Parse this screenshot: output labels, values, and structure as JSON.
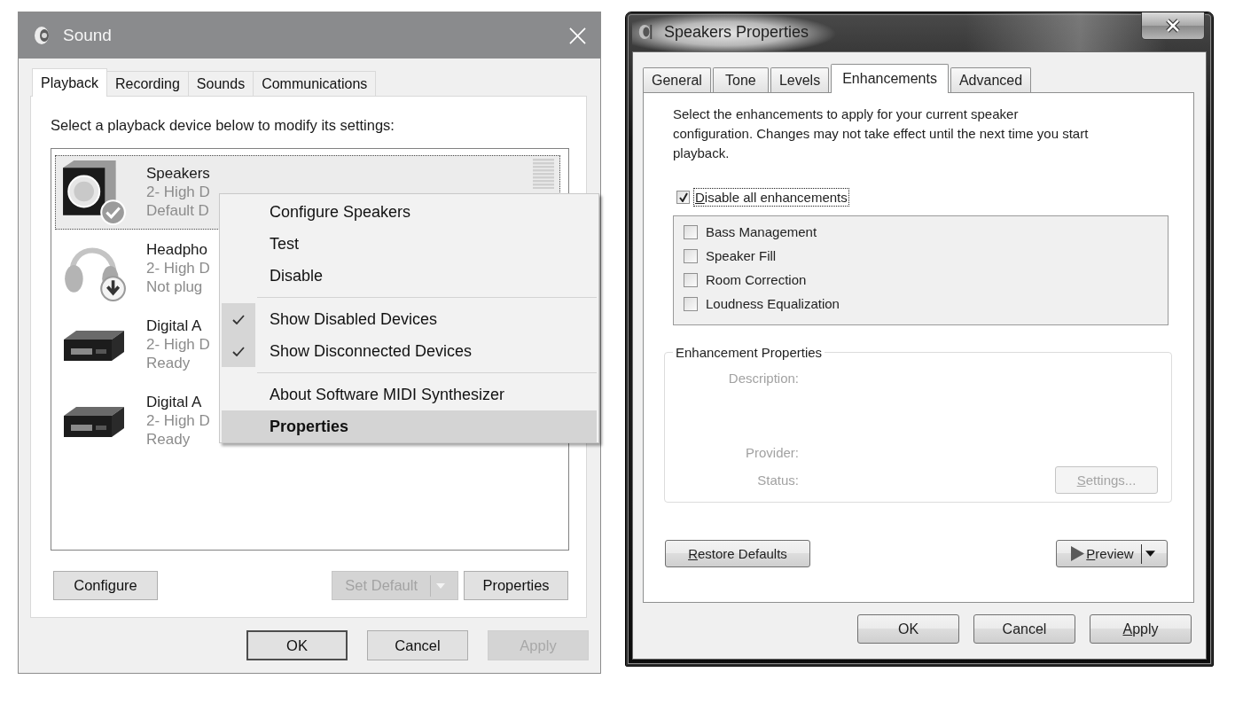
{
  "sound_window": {
    "title": "Sound",
    "tabs": [
      {
        "label": "Playback",
        "selected": true
      },
      {
        "label": "Recording",
        "selected": false
      },
      {
        "label": "Sounds",
        "selected": false
      },
      {
        "label": "Communications",
        "selected": false
      }
    ],
    "instruction": "Select a playback device below to modify its settings:",
    "devices": [
      {
        "kind": "speaker",
        "default": true,
        "unplugged": false,
        "name": "Speakers",
        "details": [
          "2- High D",
          "Default D"
        ],
        "selected": true,
        "meter": true
      },
      {
        "kind": "headphones",
        "default": false,
        "unplugged": true,
        "name": "Headpho",
        "details": [
          "2- High D",
          "Not plug"
        ],
        "selected": false,
        "meter": false
      },
      {
        "kind": "digital",
        "default": false,
        "unplugged": false,
        "name": "Digital A",
        "details": [
          "2- High D",
          "Ready"
        ],
        "selected": false,
        "meter": false
      },
      {
        "kind": "digital",
        "default": false,
        "unplugged": false,
        "name": "Digital A",
        "details": [
          "2- High D",
          "Ready"
        ],
        "selected": false,
        "meter": false
      }
    ],
    "context_menu": {
      "groups": [
        [
          {
            "label": "Configure Speakers",
            "checked": false,
            "selected": false,
            "default": false
          },
          {
            "label": "Test",
            "checked": false,
            "selected": false,
            "default": false
          },
          {
            "label": "Disable",
            "checked": false,
            "selected": false,
            "default": false
          }
        ],
        [
          {
            "label": "Show Disabled Devices",
            "checked": true,
            "selected": false,
            "default": false
          },
          {
            "label": "Show Disconnected Devices",
            "checked": true,
            "selected": false,
            "default": false
          }
        ],
        [
          {
            "label": "About Software MIDI Synthesizer",
            "checked": false,
            "selected": false,
            "default": false
          },
          {
            "label": "Properties",
            "checked": false,
            "selected": true,
            "default": true
          }
        ]
      ]
    },
    "panel_buttons": [
      {
        "label": "Configure",
        "disabled": false,
        "split": false
      },
      {
        "label": "Set Default",
        "disabled": true,
        "split": true
      },
      {
        "label": "Properties",
        "disabled": false,
        "split": false
      }
    ],
    "dialog_buttons": [
      {
        "label": "OK",
        "disabled": false,
        "default": true
      },
      {
        "label": "Cancel",
        "disabled": false,
        "default": false
      },
      {
        "label": "Apply",
        "disabled": true,
        "default": false
      }
    ]
  },
  "properties_window": {
    "title": "Speakers Properties",
    "tabs": [
      {
        "label": "General",
        "selected": false
      },
      {
        "label": "Tone",
        "selected": false
      },
      {
        "label": "Levels",
        "selected": false
      },
      {
        "label": "Enhancements",
        "selected": true
      },
      {
        "label": "Advanced",
        "selected": false
      }
    ],
    "intro": [
      "Select the enhancements to apply for your current speaker",
      "configuration. Changes may not take effect until the next time you start",
      "playback."
    ],
    "disable_all": {
      "label": "Disable all enhancements",
      "checked": true,
      "focused": true,
      "mnemonic": true
    },
    "enhancements": [
      {
        "label": "Bass Management",
        "checked": false
      },
      {
        "label": "Speaker Fill",
        "checked": false
      },
      {
        "label": "Room Correction",
        "checked": false
      },
      {
        "label": "Loudness Equalization",
        "checked": false
      }
    ],
    "properties_group": {
      "legend": "Enhancement Properties",
      "fields": [
        "Description:",
        "Provider:",
        "Status:"
      ],
      "settings_button": {
        "label": "Settings...",
        "disabled": true,
        "mnemonic": true
      }
    },
    "restore_button": {
      "label": "Restore Defaults",
      "mnemonic": true
    },
    "preview_button": {
      "label": "Preview",
      "mnemonic": true,
      "split": true
    },
    "dialog_buttons": [
      {
        "label": "OK",
        "mnemonic": false
      },
      {
        "label": "Cancel",
        "mnemonic": false
      },
      {
        "label": "Apply",
        "mnemonic": true
      }
    ]
  }
}
